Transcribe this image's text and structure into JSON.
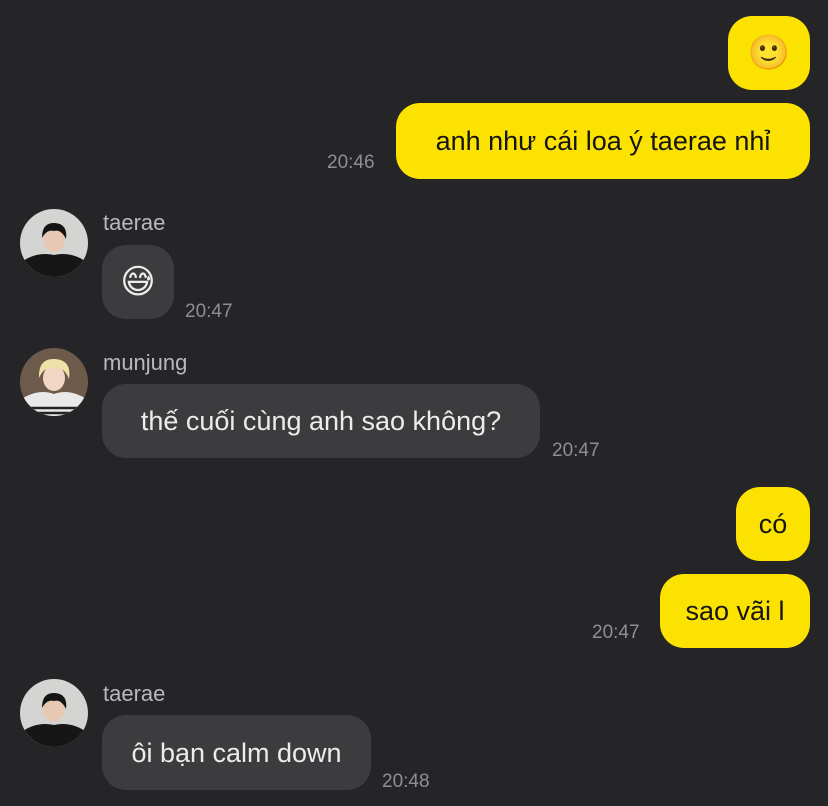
{
  "colors": {
    "background": "#252527",
    "my_bubble": "#fce200",
    "their_bubble": "#3c3c3e",
    "timestamp": "#8f8f93",
    "sender_name": "#b9b9bc"
  },
  "messages": [
    {
      "from": "me",
      "type": "emoji",
      "icon": "slightly-smiling-face-icon",
      "text": "🙂"
    },
    {
      "from": "me",
      "type": "text",
      "text": "anh như cái loa ý taerae nhỉ",
      "time": "20:46"
    },
    {
      "from": "taerae",
      "sender": "taerae",
      "avatar": "taerae-avatar",
      "type": "emoji",
      "icon": "grinning-face-with-sweat-icon",
      "text": "😅",
      "time": "20:47"
    },
    {
      "from": "munjung",
      "sender": "munjung",
      "avatar": "munjung-avatar",
      "type": "text",
      "text": "thế cuối cùng anh sao không?",
      "time": "20:47"
    },
    {
      "from": "me",
      "type": "text",
      "text": "có"
    },
    {
      "from": "me",
      "type": "text",
      "text": "sao vãi l",
      "time": "20:47"
    },
    {
      "from": "taerae",
      "sender": "taerae",
      "avatar": "taerae-avatar",
      "type": "text",
      "text": "ôi bạn calm down",
      "time": "20:48"
    }
  ]
}
